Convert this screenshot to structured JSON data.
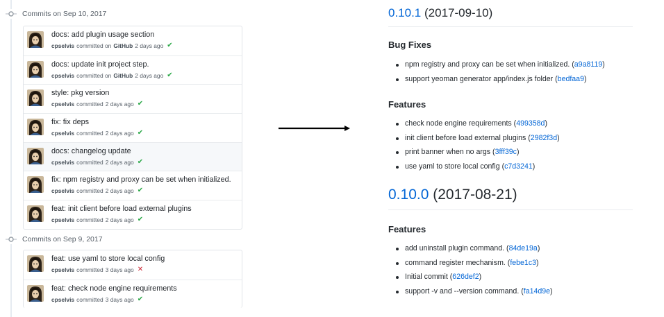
{
  "colors": {
    "link": "#0366d6",
    "success": "#28a745",
    "failure": "#cb2431",
    "muted": "#586069"
  },
  "commit_groups": [
    {
      "header": "Commits on Sep 10, 2017",
      "commits": [
        {
          "title": "docs: add plugin usage section",
          "author": "cpselvis",
          "verb": "committed on",
          "via": "GitHub",
          "when": "2 days ago",
          "status": "✔"
        },
        {
          "title": "docs: update init project step.",
          "author": "cpselvis",
          "verb": "committed on",
          "via": "GitHub",
          "when": "2 days ago",
          "status": "✔"
        },
        {
          "title": "style: pkg version",
          "author": "cpselvis",
          "verb": "committed",
          "via": "",
          "when": "2 days ago",
          "status": "✔"
        },
        {
          "title": "fix: fix deps",
          "author": "cpselvis",
          "verb": "committed",
          "via": "",
          "when": "2 days ago",
          "status": "✔"
        },
        {
          "title": "docs: changelog update",
          "author": "cpselvis",
          "verb": "committed",
          "via": "",
          "when": "2 days ago",
          "status": "✔"
        },
        {
          "title": "fix: npm registry and proxy can be set when initialized.",
          "author": "cpselvis",
          "verb": "committed",
          "via": "",
          "when": "2 days ago",
          "status": "✔"
        },
        {
          "title": "feat: init client before load external plugins",
          "author": "cpselvis",
          "verb": "committed",
          "via": "",
          "when": "2 days ago",
          "status": "✔"
        }
      ]
    },
    {
      "header": "Commits on Sep 9, 2017",
      "commits": [
        {
          "title": "feat: use yaml to store local config",
          "author": "cpselvis",
          "verb": "committed",
          "via": "",
          "when": "3 days ago",
          "status": "✕"
        },
        {
          "title": "feat: check node engine requirements",
          "author": "cpselvis",
          "verb": "committed",
          "via": "",
          "when": "3 days ago",
          "status": "✔"
        }
      ]
    }
  ],
  "changelog": {
    "v1": {
      "version": "0.10.1",
      "date": "(2017-09-10)",
      "bugfixes_heading": "Bug Fixes",
      "bugfixes": [
        {
          "text": "npm registry and proxy can be set when initialized. ",
          "open": "(",
          "hash": "a9a8119",
          "close": ")"
        },
        {
          "text": "support yeoman generator app/index.js folder ",
          "open": "(",
          "hash": "bedfaa9",
          "close": ")"
        }
      ],
      "features_heading": "Features",
      "features": [
        {
          "text": "check node engine requirements ",
          "open": "(",
          "hash": "499358d",
          "close": ")"
        },
        {
          "text": "init client before load external plugins ",
          "open": "(",
          "hash": "2982f3d",
          "close": ")"
        },
        {
          "text": "print banner when no args ",
          "open": "(",
          "hash": "3fff39c",
          "close": ")"
        },
        {
          "text": "use yaml to store local config ",
          "open": "(",
          "hash": "c7d3241",
          "close": ")"
        }
      ]
    },
    "v2": {
      "version": "0.10.0",
      "date": "(2017-08-21)",
      "features_heading": "Features",
      "features": [
        {
          "text": "add uninstall plugin command. ",
          "open": "(",
          "hash": "84de19a",
          "close": ")"
        },
        {
          "text": "command register mechanism. ",
          "open": "(",
          "hash": "febe1c3",
          "close": ")"
        },
        {
          "text": "Initial commit ",
          "open": "(",
          "hash": "626def2",
          "close": ")"
        },
        {
          "text": "support -v and --version command. ",
          "open": "(",
          "hash": "fa14d9e",
          "close": ")"
        }
      ]
    }
  }
}
